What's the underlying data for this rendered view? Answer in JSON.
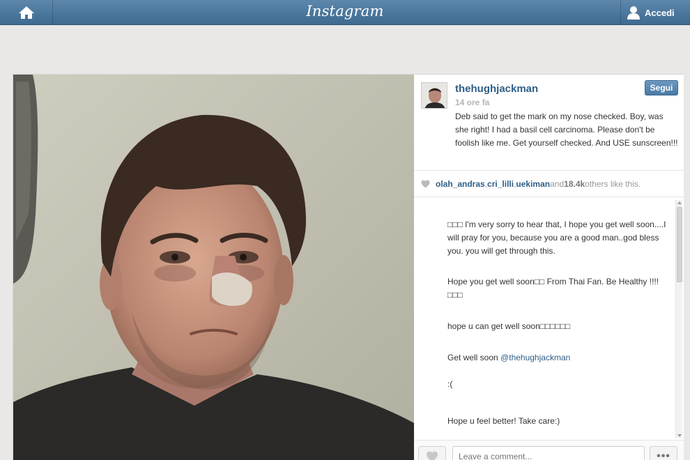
{
  "header": {
    "brand": "Instagram",
    "login_label": "Accedi"
  },
  "post": {
    "username": "thehughjackman",
    "time_ago": "14 ore fa",
    "follow_label": "Segui",
    "caption": "Deb said to get the mark on my nose checked. Boy, was she right! I had a basil cell carcinoma. Please don't be foolish like me. Get yourself checked. And USE sunscreen!!!",
    "likes": {
      "user1": "olah_andras",
      "sep1": ", ",
      "user2": "cri_lilli",
      "sep2": ", ",
      "user3": "uekiman",
      "and": " and ",
      "count": "18.4k",
      "suffix": " others like this."
    },
    "comments": [
      {
        "text": "□□□ I'm very sorry to hear that, I hope you get well soon....I will pray for you, because you are a good man..god bless you. you will get through this."
      },
      {
        "text": "Hope you get well soon□□ From Thai Fan. Be Healthy !!!! □□□"
      },
      {
        "text": "hope u can get well soon□□□□□□"
      },
      {
        "text": "Get well soon ",
        "mention": "@thehughjackman"
      },
      {
        "text": ":("
      },
      {
        "text": "Hope u feel better! Take care:)"
      }
    ],
    "comment_placeholder": "Leave a comment...",
    "more_label": "•••"
  }
}
